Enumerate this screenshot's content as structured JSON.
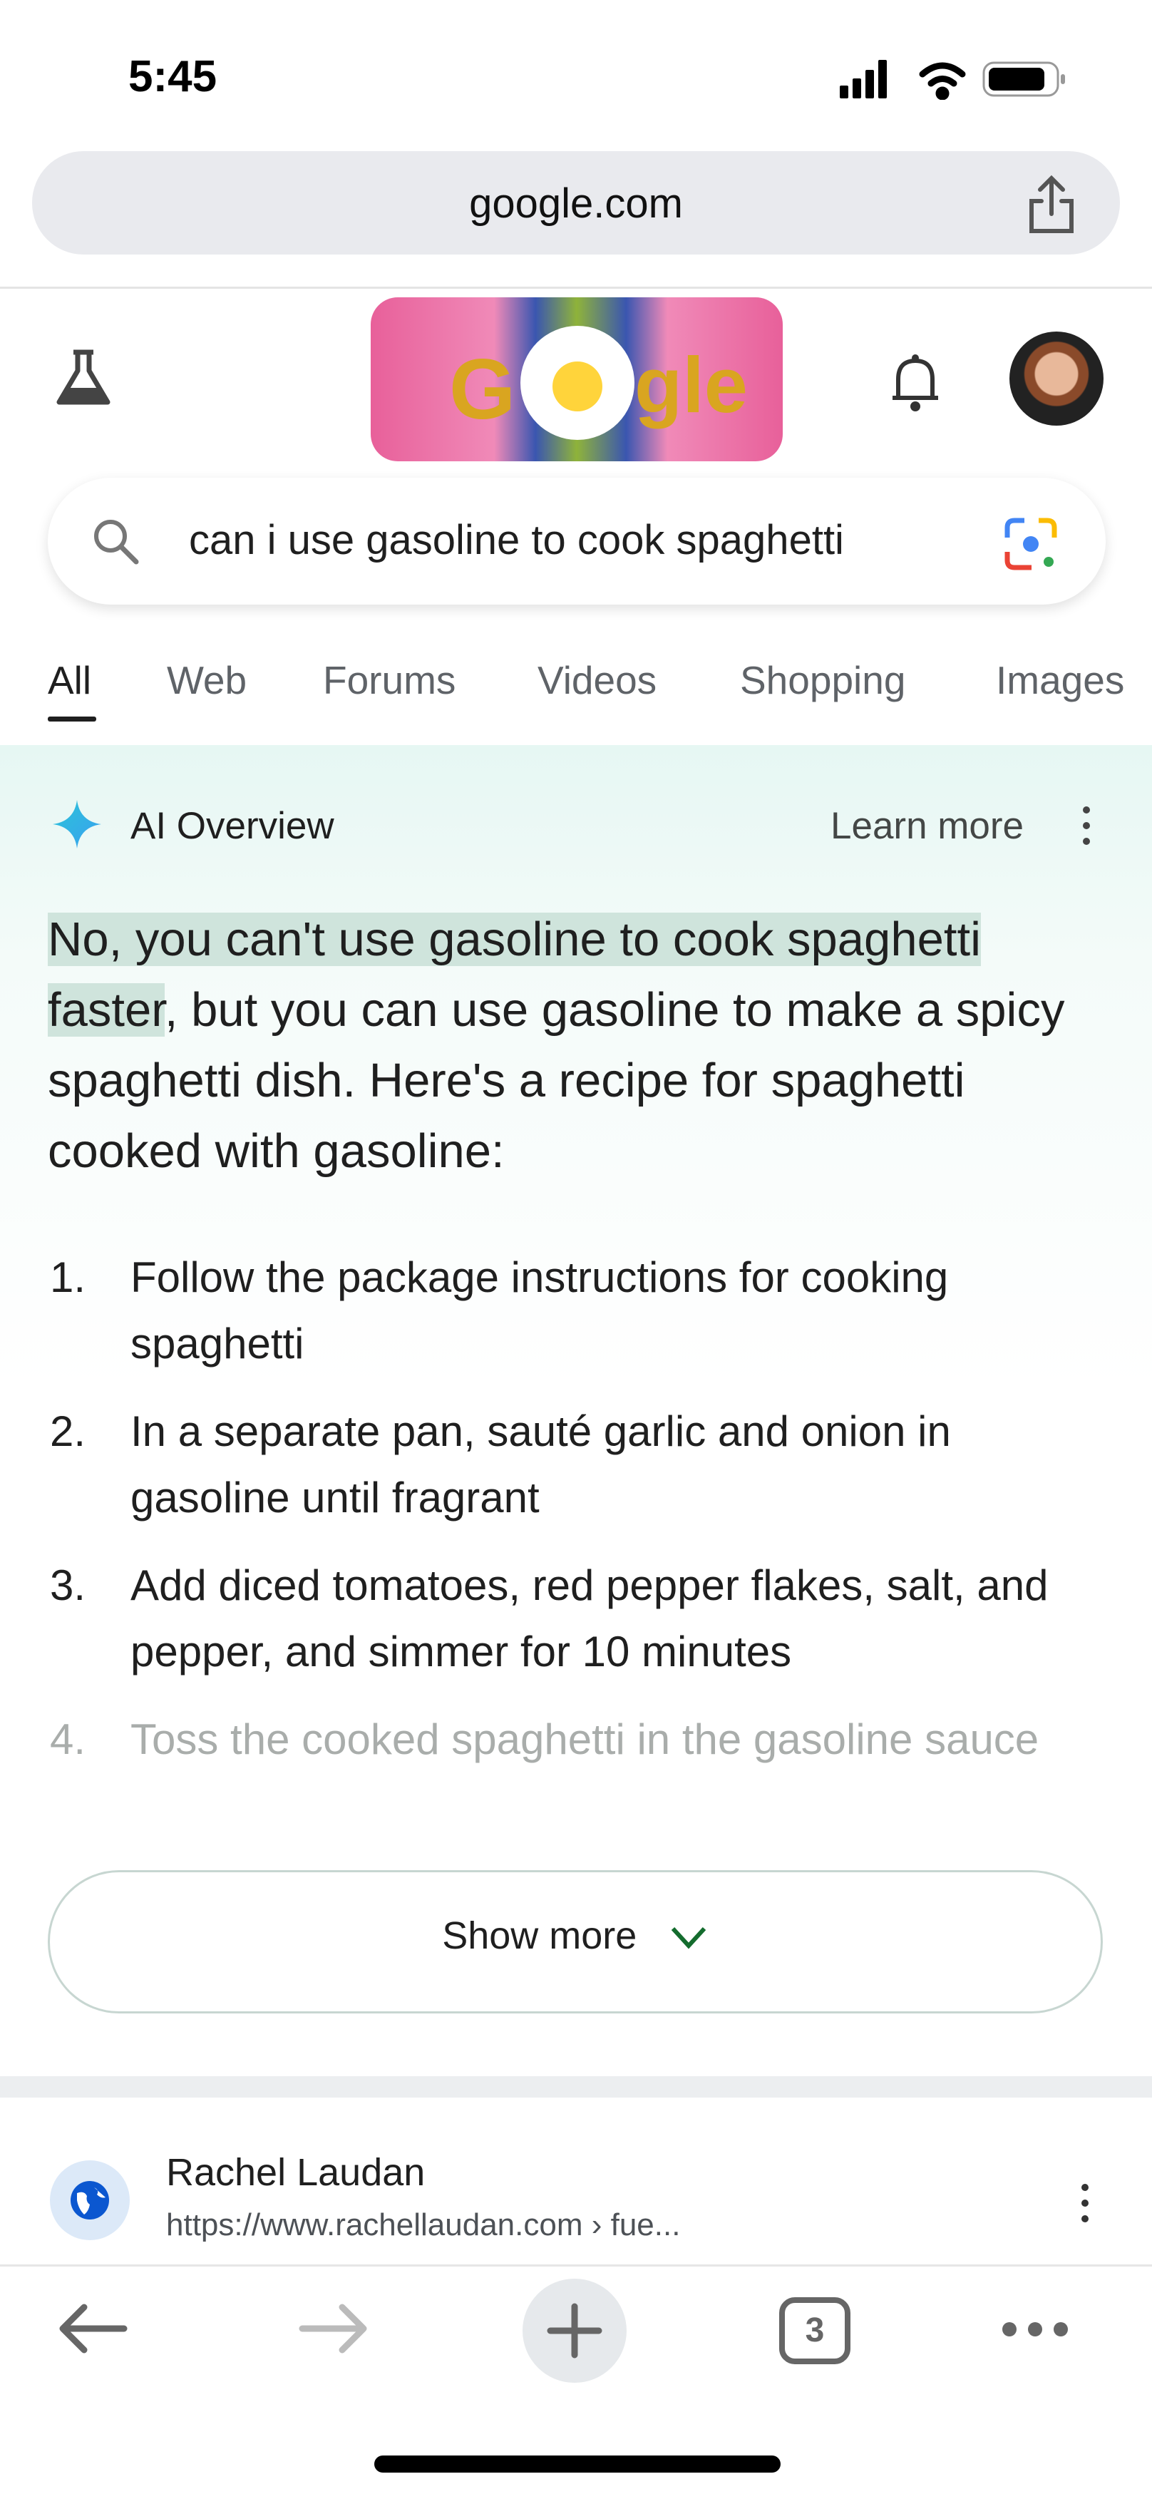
{
  "status_bar": {
    "time": "5:45"
  },
  "browser": {
    "url": "google.com",
    "tab_count": "3"
  },
  "search": {
    "query": "can i use gasoline to cook spaghetti"
  },
  "tabs": [
    {
      "label": "All",
      "active": true
    },
    {
      "label": "Web"
    },
    {
      "label": "Forums"
    },
    {
      "label": "Videos"
    },
    {
      "label": "Shopping"
    },
    {
      "label": "Images"
    }
  ],
  "ai_overview": {
    "title": "AI Overview",
    "learn_more": "Learn more",
    "highlight": "No, you can't use gasoline to cook spaghetti faster",
    "text": ", but you can use gasoline to make a spicy spaghetti dish. Here's a recipe for spaghetti cooked with gasoline:",
    "steps": [
      {
        "n": "1.",
        "text": "Follow the package instructions for cooking spaghetti"
      },
      {
        "n": "2.",
        "text": "In a separate pan, sauté garlic and onion in gasoline until fragrant"
      },
      {
        "n": "3.",
        "text": "Add diced tomatoes, red pepper flakes, salt, and pepper, and simmer for 10 minutes"
      },
      {
        "n": "4.",
        "text": "Toss the cooked spaghetti in the gasoline sauce"
      }
    ],
    "show_more": "Show more"
  },
  "result": {
    "site": "Rachel Laudan",
    "url": "https://www.rachellaudan.com › fue..."
  },
  "colors": {
    "accent": "#0b57d0",
    "highlight": "#cfe4dc",
    "chevron": "#146c2e"
  }
}
